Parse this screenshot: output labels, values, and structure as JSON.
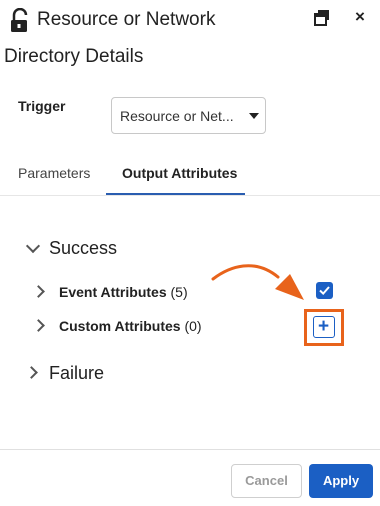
{
  "header": {
    "title_line1": "Resource or Network",
    "title_line2": "Directory Details",
    "icons": {
      "lock": "unlocked-padlock-icon",
      "popout": "popout-window-icon",
      "close": "close-icon"
    },
    "close_glyph": "×"
  },
  "trigger": {
    "label": "Trigger",
    "selected_value": "Resource or Net..."
  },
  "tabs": [
    {
      "label": "Parameters",
      "active": false
    },
    {
      "label": "Output Attributes",
      "active": true
    }
  ],
  "tree": {
    "success": {
      "label": "Success",
      "expanded": true,
      "children": [
        {
          "label": "Event Attributes",
          "count": "(5)",
          "expanded": false,
          "control": "checkbox",
          "checked": true
        },
        {
          "label": "Custom Attributes",
          "count": "(0)",
          "expanded": false,
          "control": "add-button",
          "add_glyph": "+"
        }
      ]
    },
    "failure": {
      "label": "Failure",
      "expanded": false
    }
  },
  "annotation": {
    "color": "#e8631b",
    "type": "curved-arrow-and-highlight-box"
  },
  "footer": {
    "cancel_label": "Cancel",
    "apply_label": "Apply"
  },
  "colors": {
    "accent": "#1b5fc4",
    "highlight": "#e8631b",
    "tab_underline": "#2a5db0"
  }
}
